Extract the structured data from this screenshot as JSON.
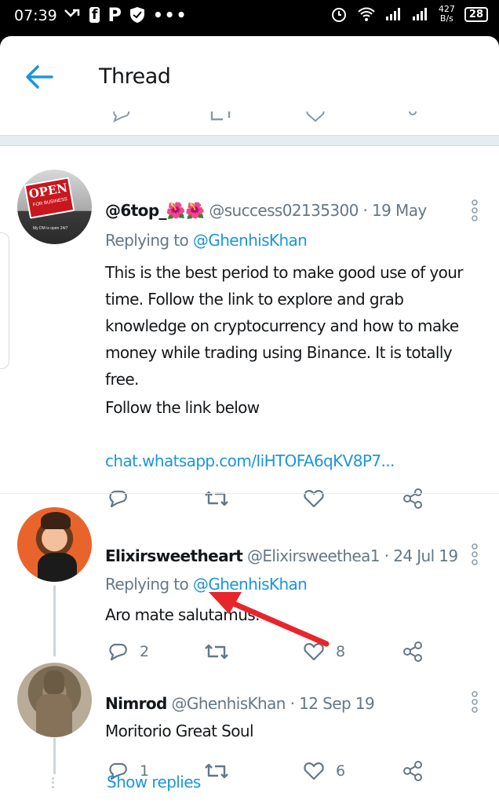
{
  "status_bar": {
    "time": "07:39",
    "left_icons": [
      "missed-call-icon",
      "facebook-icon",
      "p-app-icon",
      "shield-icon",
      "more-dots-icon"
    ],
    "speed_value": "427",
    "speed_unit": "B/s",
    "battery": "28"
  },
  "header": {
    "title": "Thread"
  },
  "tweets": [
    {
      "name": "@6top_🌺🌺",
      "handle": "@success02135300",
      "date": "· 19 May",
      "replying_prefix": "Replying to",
      "replying_to": "@GhenhisKhan",
      "body_lines": [
        "This is the best period to make good use of your time. Follow the link to explore and grab knowledge on cryptocurrency and how to make money while trading using Binance. It is totally free.",
        "Follow the link below"
      ],
      "link": "chat.whatsapp.com/IiHTOFA6qKV8P7...",
      "avatar_text": "OPEN",
      "avatar_subtext": "FOR BUSINESS",
      "avatar_caption": "My DM is open 24/7",
      "replies": "",
      "likes": ""
    },
    {
      "name": "Elixirsweetheart",
      "handle": "@Elixirsweethea1",
      "date": "· 24 Jul 19",
      "replying_prefix": "Replying to",
      "replying_to": "@GhenhisKhan",
      "body": "Aro mate salutamus.",
      "replies": "2",
      "likes": "8"
    },
    {
      "name": "Nimrod",
      "handle": "@GhenhisKhan",
      "date": "· 12 Sep 19",
      "body": "Moritorio Great Soul",
      "replies": "1",
      "likes": "6"
    }
  ],
  "show_replies": "Show replies",
  "colors": {
    "accent": "#1b95e0",
    "secondary_text": "#657786",
    "annotation_arrow": "#e8252a"
  }
}
